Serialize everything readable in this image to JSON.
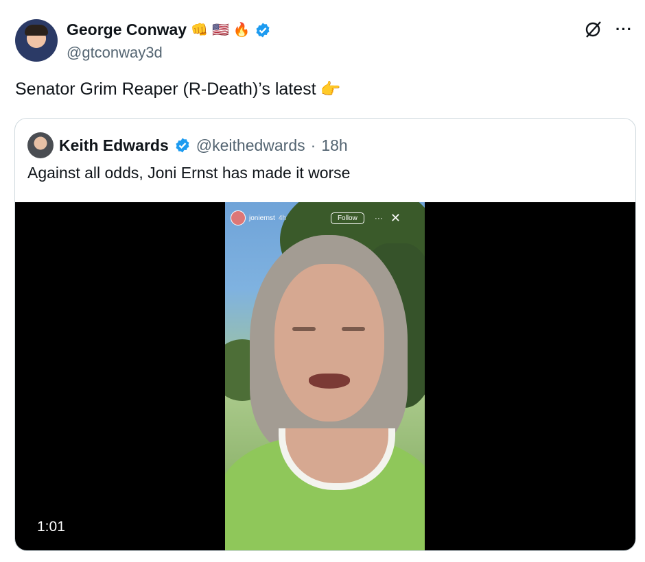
{
  "tweet": {
    "author_name": "George Conway",
    "emojis": [
      "👊",
      "🇺🇸",
      "🔥"
    ],
    "handle": "@gtconway3d",
    "text": "Senator Grim Reaper (R-Death)’s latest",
    "text_emoji": "👉"
  },
  "quoted_tweet": {
    "author_name": "Keith Edwards",
    "handle": "@keithedwards",
    "separator": "·",
    "time": "18h",
    "text": "Against all odds, Joni Ernst has made it worse"
  },
  "video": {
    "duration": "1:01",
    "story_user": "joniernst",
    "story_time": "4h",
    "follow_label": "Follow",
    "more_glyph": "···",
    "close_glyph": "✕"
  },
  "icons": {
    "more": "···",
    "verified_color": "#1d9bf0"
  }
}
